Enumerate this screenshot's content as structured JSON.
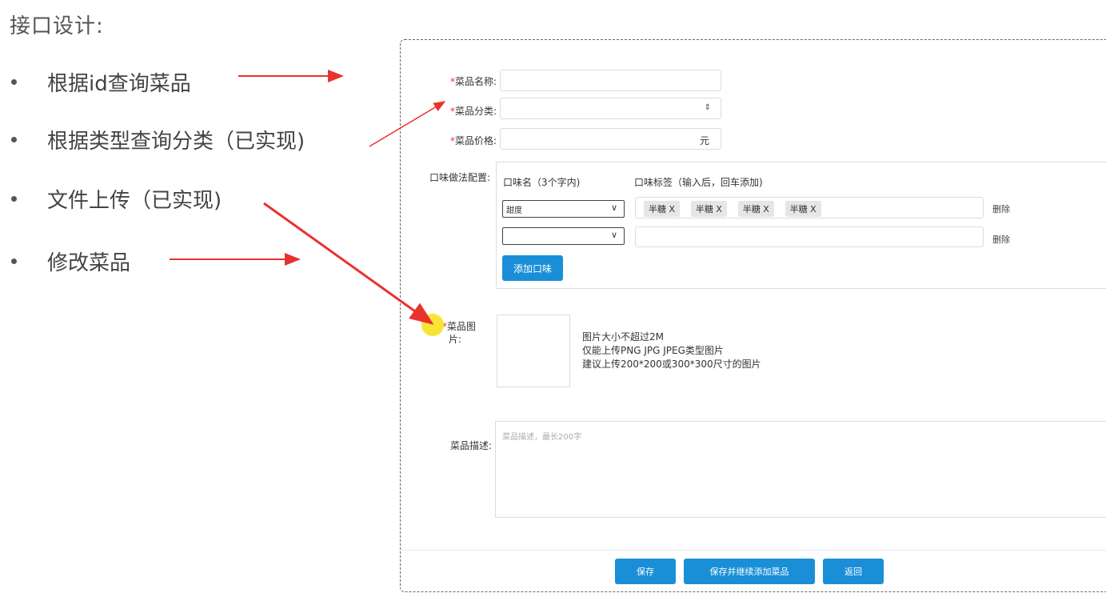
{
  "slide": {
    "title": "接口设计:",
    "bullets": [
      "根据id查询菜品",
      "根据类型查询分类（已实现)",
      "文件上传（已实现)",
      "修改菜品"
    ]
  },
  "form": {
    "required_mark": "*",
    "name_label": "菜品名称:",
    "category_label": "菜品分类:",
    "category_select_icon": "⇕",
    "price_label": "菜品价格:",
    "price_unit": "元",
    "flavor_label": "口味做法配置:",
    "flavor_name_header": "口味名（3个字内)",
    "flavor_tag_header": "口味标签（输入后，回车添加)",
    "flavor_rows": [
      {
        "name": "甜度",
        "tags": [
          "半糖 X",
          "半糖 X",
          "半糖 X",
          "半糖 X"
        ],
        "delete": "删除"
      },
      {
        "name": "",
        "tags": [],
        "delete": "删除"
      }
    ],
    "add_flavor_button": "添加口味",
    "image_label_line1": "菜品图",
    "image_label_line2": "片:",
    "image_hints": [
      "图片大小不超过2M",
      "仅能上传PNG JPG JPEG类型图片",
      "建议上传200*200或300*300尺寸的图片"
    ],
    "desc_label": "菜品描述:",
    "desc_placeholder": "菜品描述，最长200字"
  },
  "footer": {
    "save": "保存",
    "save_continue": "保存并继续添加菜品",
    "back": "返回"
  },
  "colors": {
    "accent": "#1a8fd8",
    "arrow": "#e8322e",
    "required": "#ee3333",
    "marker": "#f7e11e"
  }
}
